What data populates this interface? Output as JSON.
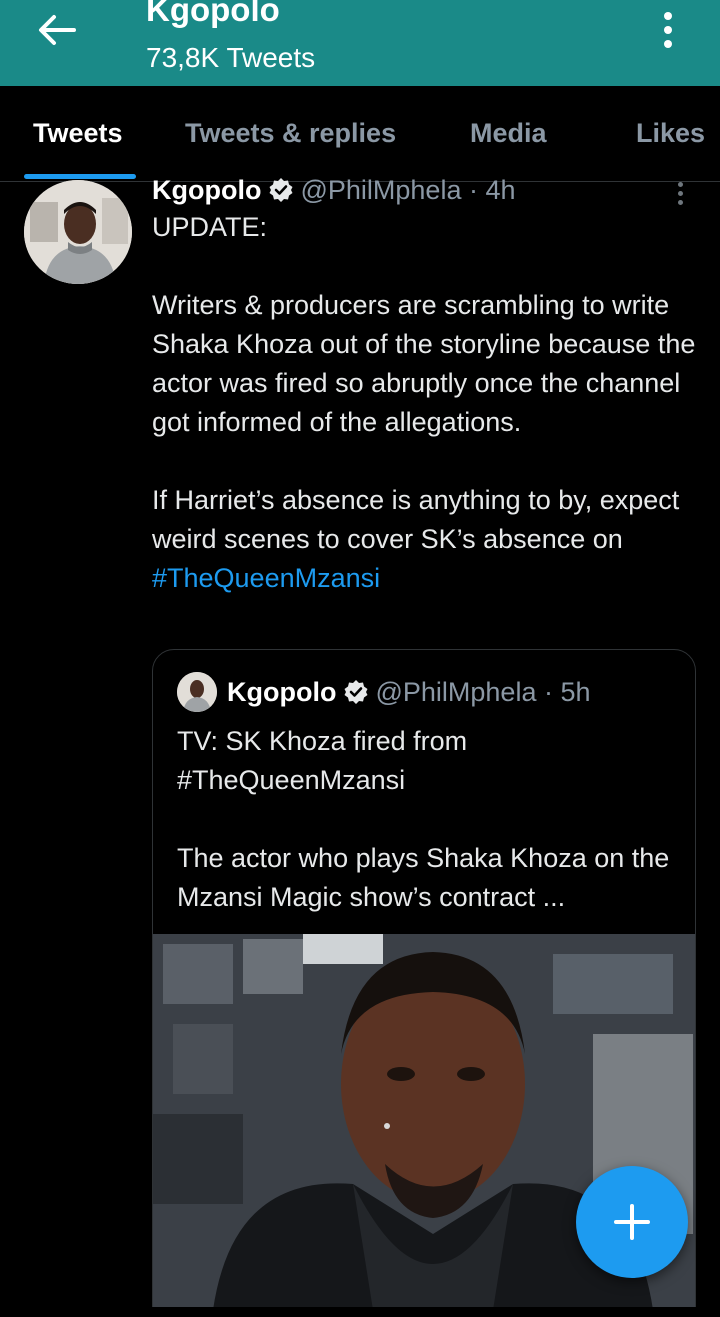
{
  "header": {
    "title": "Kgopolo",
    "subtitle": "73,8K Tweets",
    "bg_color": "#1a8a88",
    "back_icon": "arrow-left-icon",
    "more_icon": "more-vertical-icon"
  },
  "tabs": [
    {
      "label": "Tweets",
      "active": true
    },
    {
      "label": "Tweets & replies",
      "active": false
    },
    {
      "label": "Media",
      "active": false
    },
    {
      "label": "Likes",
      "active": false
    }
  ],
  "tweet": {
    "name": "Kgopolo",
    "handle": "@PhilMphela · 4h",
    "text_main": "UPDATE:\n\nWriters & producers are scrambling to write Shaka Khoza out of the storyline because the actor was fired so abruptly once the channel got informed of the allegations.\n\nIf Harriet’s absence is anything to by, expect weird scenes to cover SK’s absence on ",
    "hashtag": "#TheQueenMzansi",
    "accent_color": "#1d9bf0"
  },
  "quoted_tweet": {
    "name": "Kgopolo",
    "handle": "@PhilMphela · 5h",
    "text": "TV: SK Khoza fired from\n#TheQueenMzansi\n\nThe actor who plays Shaka Khoza on the Mzansi Magic show’s contract ..."
  },
  "fab": {
    "icon": "plus-icon"
  }
}
